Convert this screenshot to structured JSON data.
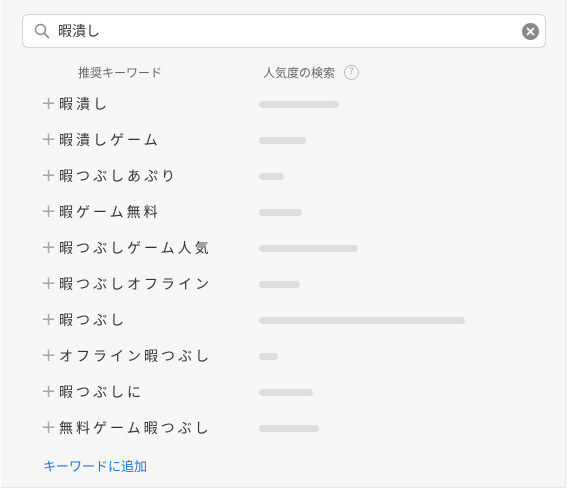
{
  "search": {
    "value": "暇潰し",
    "placeholder": "",
    "search_icon": "search-icon",
    "clear_icon": "clear-circle-icon"
  },
  "headers": {
    "keyword": "推奨キーワード",
    "popularity": "人気度の検索",
    "help_glyph": "?"
  },
  "add_icon": "+",
  "keywords": [
    {
      "label": "暇潰し",
      "popularity": 0.39
    },
    {
      "label": "暇潰しゲーム",
      "popularity": 0.23
    },
    {
      "label": "暇つぶしあぷり",
      "popularity": 0.12
    },
    {
      "label": "暇ゲーム無料",
      "popularity": 0.21
    },
    {
      "label": "暇つぶしゲーム人気",
      "popularity": 0.48
    },
    {
      "label": "暇つぶしオフライン",
      "popularity": 0.2
    },
    {
      "label": "暇つぶし",
      "popularity": 1.0
    },
    {
      "label": "オフライン暇つぶし",
      "popularity": 0.09
    },
    {
      "label": "暇つぶしに",
      "popularity": 0.26
    },
    {
      "label": "無料ゲーム暇つぶし",
      "popularity": 0.29
    }
  ],
  "footer": {
    "add_link": "キーワードに追加"
  },
  "colors": {
    "link": "#1a73e8",
    "bar": "#dddddd",
    "panel": "#f7f7f7"
  }
}
